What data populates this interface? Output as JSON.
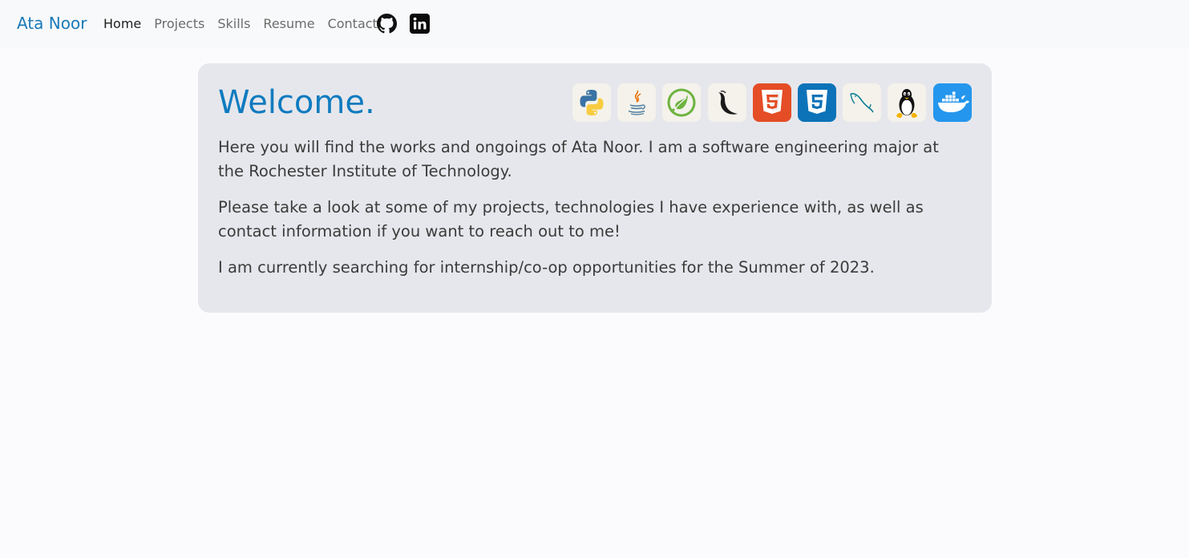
{
  "nav": {
    "brand": "Ata Noor",
    "links": [
      {
        "label": "Home",
        "active": true
      },
      {
        "label": "Projects",
        "active": false
      },
      {
        "label": "Skills",
        "active": false
      },
      {
        "label": "Resume",
        "active": false
      },
      {
        "label": "Contact",
        "active": false
      }
    ],
    "social": [
      "github-icon",
      "linkedin-icon"
    ]
  },
  "hero": {
    "title": "Welcome.",
    "technologies": [
      "python-icon",
      "java-icon",
      "spring-icon",
      "flask-icon",
      "html5-icon",
      "css3-icon",
      "mysql-icon",
      "linux-icon",
      "docker-icon"
    ],
    "paragraphs": [
      "Here you will find the works and ongoings of Ata Noor. I am a software engineering major at the Rochester Institute of Technology.",
      "Please take a look at some of my projects, technologies I have experience with, as well as contact information if you want to reach out to me!",
      "I am currently searching for internship/co-op opportunities for the Summer of 2023."
    ]
  },
  "colors": {
    "brand": "#1a7ab8",
    "heading": "#0f7bbf",
    "card_bg": "#e6e7ec",
    "navbar_bg": "#f8f9fa"
  }
}
